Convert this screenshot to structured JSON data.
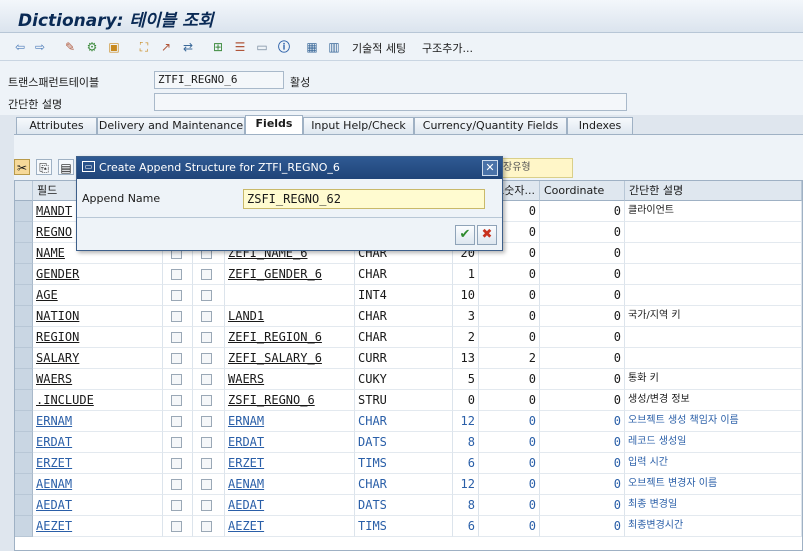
{
  "window": {
    "title": "Dictionary: 테이블 조회"
  },
  "toolbar": {
    "tech_settings": "기술적 세팅",
    "append_struct": "구조추가..."
  },
  "header": {
    "table_label": "트랜스패런트테이블",
    "table_value": "ZTFI_REGNO_6",
    "status": "활성",
    "desc_label": "간단한 설명",
    "desc_value": ""
  },
  "tabs": [
    "Attributes",
    "Delivery and Maintenance",
    "Fields",
    "Input Help/Check",
    "Currency/Quantity Fields",
    "Indexes"
  ],
  "active_tab": "Fields",
  "behind_field": "장유형",
  "grid": {
    "columns": {
      "field": "필드",
      "decimals": "소숫자...",
      "coordinate": "Coordinate",
      "desc": "간단한 설명"
    },
    "rows": [
      {
        "field": "MANDT",
        "element": "",
        "type": "",
        "length": "",
        "decimals": "0",
        "coord": "0",
        "desc": "클라이언트",
        "blue": false
      },
      {
        "field": "REGNO",
        "element": "",
        "type": "",
        "length": "",
        "decimals": "0",
        "coord": "0",
        "desc": "",
        "blue": false
      },
      {
        "field": "NAME",
        "element": "ZEFI_NAME_6",
        "type": "CHAR",
        "length": "20",
        "decimals": "0",
        "coord": "0",
        "desc": "",
        "blue": false
      },
      {
        "field": "GENDER",
        "element": "ZEFI_GENDER_6",
        "type": "CHAR",
        "length": "1",
        "decimals": "0",
        "coord": "0",
        "desc": "",
        "blue": false
      },
      {
        "field": "AGE",
        "element": "",
        "type": "INT4",
        "length": "10",
        "decimals": "0",
        "coord": "0",
        "desc": "",
        "blue": false
      },
      {
        "field": "NATION",
        "element": "LAND1",
        "type": "CHAR",
        "length": "3",
        "decimals": "0",
        "coord": "0",
        "desc": "국가/지역 키",
        "blue": false
      },
      {
        "field": "REGION",
        "element": "ZEFI_REGION_6",
        "type": "CHAR",
        "length": "2",
        "decimals": "0",
        "coord": "0",
        "desc": "",
        "blue": false
      },
      {
        "field": "SALARY",
        "element": "ZEFI_SALARY_6",
        "type": "CURR",
        "length": "13",
        "decimals": "2",
        "coord": "0",
        "desc": "",
        "blue": false
      },
      {
        "field": "WAERS",
        "element": "WAERS",
        "type": "CUKY",
        "length": "5",
        "decimals": "0",
        "coord": "0",
        "desc": "통화 키",
        "blue": false
      },
      {
        "field": ".INCLUDE",
        "element": "ZSFI_REGNO_6",
        "type": "STRU",
        "length": "0",
        "decimals": "0",
        "coord": "0",
        "desc": "생성/변경 정보",
        "blue": false
      },
      {
        "field": "ERNAM",
        "element": "ERNAM",
        "type": "CHAR",
        "length": "12",
        "decimals": "0",
        "coord": "0",
        "desc": "오브젝트 생성 책임자 이름",
        "blue": true
      },
      {
        "field": "ERDAT",
        "element": "ERDAT",
        "type": "DATS",
        "length": "8",
        "decimals": "0",
        "coord": "0",
        "desc": "레코드 생성일",
        "blue": true
      },
      {
        "field": "ERZET",
        "element": "ERZET",
        "type": "TIMS",
        "length": "6",
        "decimals": "0",
        "coord": "0",
        "desc": "입력 시간",
        "blue": true
      },
      {
        "field": "AENAM",
        "element": "AENAM",
        "type": "CHAR",
        "length": "12",
        "decimals": "0",
        "coord": "0",
        "desc": "오브젝트 변경자 이름",
        "blue": true
      },
      {
        "field": "AEDAT",
        "element": "AEDAT",
        "type": "DATS",
        "length": "8",
        "decimals": "0",
        "coord": "0",
        "desc": "최종 변경일",
        "blue": true
      },
      {
        "field": "AEZET",
        "element": "AEZET",
        "type": "TIMS",
        "length": "6",
        "decimals": "0",
        "coord": "0",
        "desc": "최종변경시간",
        "blue": true
      }
    ]
  },
  "dialog": {
    "title": "Create Append Structure for ZTFI_REGNO_6",
    "name_label": "Append Name",
    "name_value": "ZSFI_REGNO_62",
    "confirm_icon": "checkmark-icon",
    "cancel_icon": "cancel-icon"
  }
}
